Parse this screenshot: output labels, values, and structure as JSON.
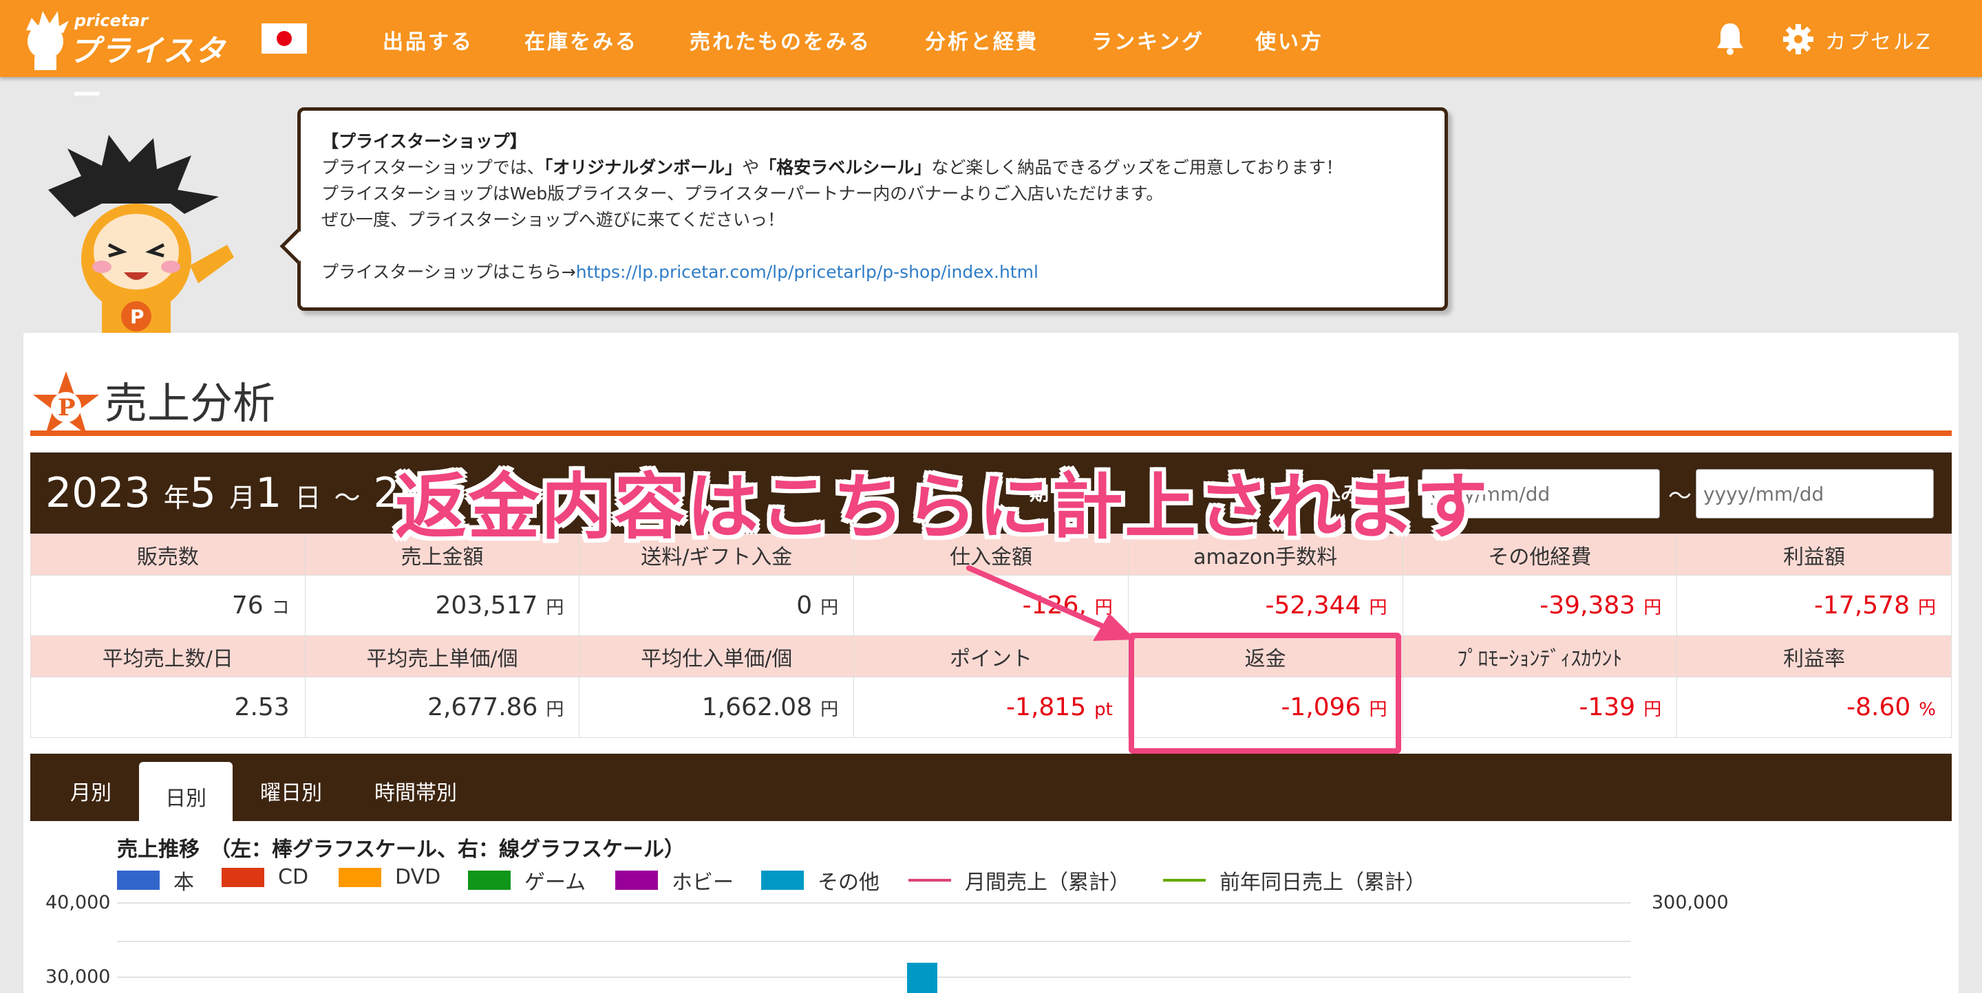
{
  "header": {
    "logo_sub": "pricetar",
    "logo_main": "プライスター",
    "nav": [
      "出品する",
      "在庫をみる",
      "売れたものをみる",
      "分析と経費",
      "ランキング",
      "使い方"
    ],
    "user_name": "カプセルZ"
  },
  "notice": {
    "title": "【プライスターショップ】",
    "line1_a": "プライスターショップでは、",
    "line1_b": "「オリジナルダンボール」",
    "line1_c": "や",
    "line1_d": "「格安ラベルシール」",
    "line1_e": "など楽しく納品できるグッズをご用意しております！",
    "line2": "プライスターショップはWeb版プライスター、プライスターパートナー内のバナーよりご入店いただけます。",
    "line3": "ぜひ一度、プライスターショップへ遊びに来てくださいっ！",
    "line4_prefix": "プライスターショップはこちら→",
    "link": "https://lp.pricetar.com/lp/pricetarlp/p-shop/index.html"
  },
  "page": {
    "title": "売上分析",
    "date_year": "2023",
    "date_year_unit": "年",
    "date_month": "5",
    "date_month_unit": "月",
    "date_day": "1",
    "date_day_unit": "日",
    "date_sep": "～",
    "date_end_partial": "202",
    "date_mid_partial": "期",
    "filter_label_partial": "込み",
    "date_from_placeholder": "yyyy/mm/dd",
    "date_to_placeholder": "yyyy/mm/dd",
    "date_range_sep": "～"
  },
  "stats_row1": {
    "headers": [
      "販売数",
      "売上金額",
      "送料/ギフト入金",
      "仕入金額",
      "amazon手数料",
      "その他経費",
      "利益額"
    ],
    "values": [
      "76",
      "203,517",
      "0",
      "-126,",
      "-52,344",
      "-39,383",
      "-17,578"
    ],
    "units": [
      "コ",
      "円",
      "円",
      "円",
      "円",
      "円",
      "円"
    ]
  },
  "stats_row2": {
    "headers": [
      "平均売上数/日",
      "平均売上単価/個",
      "平均仕入単価/個",
      "ポイント",
      "返金",
      "ﾌﾟﾛﾓｰｼｮﾝﾃﾞｨｽｶｳﾝﾄ",
      "利益率"
    ],
    "values": [
      "2.53",
      "2,677.86",
      "1,662.08",
      "-1,815",
      "-1,096",
      "-139",
      "-8.60"
    ],
    "units": [
      "",
      "円",
      "円",
      "pt",
      "円",
      "円",
      "%"
    ]
  },
  "tabs": [
    "月別",
    "日別",
    "曜日別",
    "時間帯別"
  ],
  "active_tab": "日別",
  "annotation": "返金内容はこちらに計上されます",
  "chart_data": {
    "type": "bar",
    "title": "売上推移　（左：棒グラフスケール、右：線グラフスケール）",
    "legend": [
      {
        "name": "本",
        "color": "#3366cc",
        "kind": "bar"
      },
      {
        "name": "CD",
        "color": "#dc3912",
        "kind": "bar"
      },
      {
        "name": "DVD",
        "color": "#ff9900",
        "kind": "bar"
      },
      {
        "name": "ゲーム",
        "color": "#109618",
        "kind": "bar"
      },
      {
        "name": "ホビー",
        "color": "#990099",
        "kind": "bar"
      },
      {
        "name": "その他",
        "color": "#0099c6",
        "kind": "bar"
      },
      {
        "name": "月間売上（累計）",
        "color": "#dd4477",
        "kind": "line"
      },
      {
        "name": "前年同日売上（累計）",
        "color": "#66aa00",
        "kind": "line"
      }
    ],
    "y_left_ticks": [
      "40,000",
      "30,000"
    ],
    "y_right_ticks": [
      "300,000"
    ],
    "visible_bar": {
      "series": "その他",
      "value_min": 30000
    }
  }
}
